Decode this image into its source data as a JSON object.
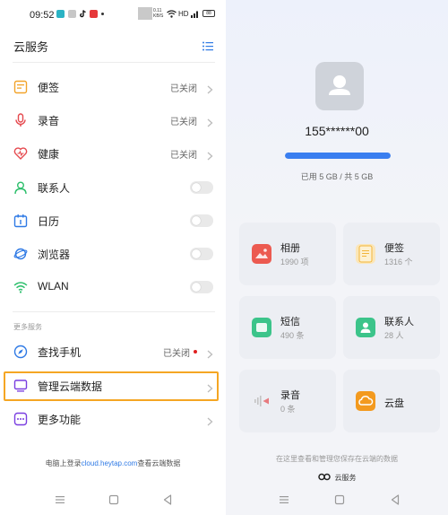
{
  "status_bar": {
    "time": "09:52",
    "speed": "0.11\nKB/S",
    "hd": "HD",
    "battery": "88"
  },
  "header": {
    "title": "云服务"
  },
  "settings": [
    {
      "label": "便签",
      "status": "已关闭",
      "control": "chevron"
    },
    {
      "label": "录音",
      "status": "已关闭",
      "control": "chevron"
    },
    {
      "label": "健康",
      "status": "已关闭",
      "control": "chevron"
    },
    {
      "label": "联系人",
      "status": "",
      "control": "toggle"
    },
    {
      "label": "日历",
      "status": "",
      "control": "toggle"
    },
    {
      "label": "浏览器",
      "status": "",
      "control": "toggle"
    },
    {
      "label": "WLAN",
      "status": "",
      "control": "toggle"
    }
  ],
  "more_services": {
    "section_label": "更多服务",
    "find_phone": {
      "label": "查找手机",
      "status": "已关闭"
    },
    "manage_data": {
      "label": "管理云端数据"
    },
    "more_features": {
      "label": "更多功能"
    }
  },
  "footer": {
    "prefix": "电脑上登录",
    "link": "cloud.heytap.com",
    "suffix": "查看云端数据"
  },
  "account": {
    "id": "155******00",
    "storage": "已用 5 GB / 共 5 GB",
    "usage_fraction": 1.0
  },
  "cards": [
    {
      "name": "相册",
      "count": "1990 项"
    },
    {
      "name": "便签",
      "count": "1316 个"
    },
    {
      "name": "短信",
      "count": "490 条"
    },
    {
      "name": "联系人",
      "count": "28 人"
    },
    {
      "name": "录音",
      "count": "0 条"
    },
    {
      "name": "云盘",
      "count": ""
    }
  ],
  "right_footer": {
    "note": "在这里查看和管理您保存在云端的数据",
    "brand": "云服务"
  },
  "colors": {
    "accent": "#3a7ef0",
    "highlight": "#f5a623",
    "link": "#2f7ae5"
  }
}
